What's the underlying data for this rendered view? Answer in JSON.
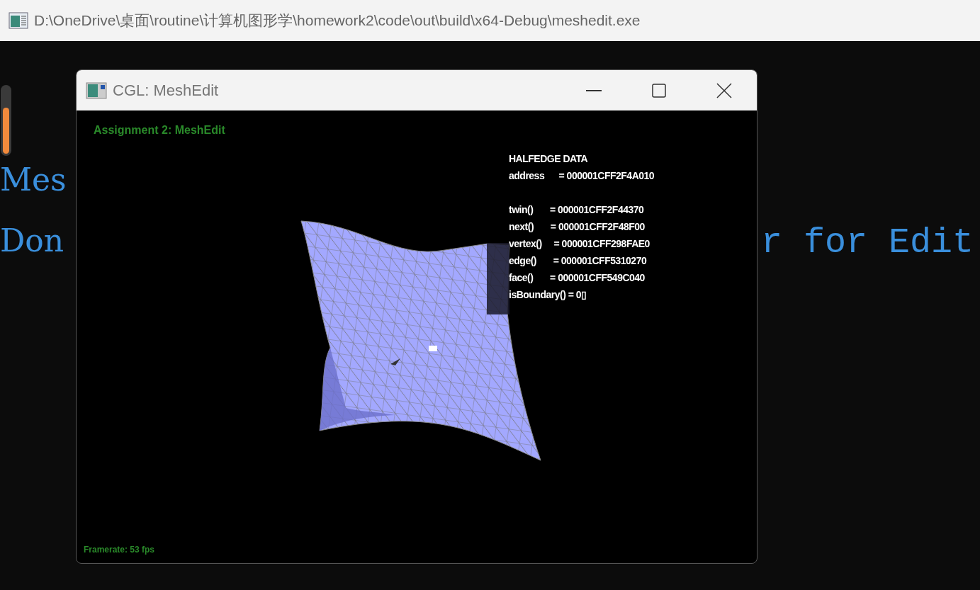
{
  "app_window": {
    "title": "D:\\OneDrive\\桌面\\routine\\计算机图形学\\homework2\\code\\out\\build\\x64-Debug\\meshedit.exe"
  },
  "console_text": {
    "line_1": "Mes",
    "line_2_left": "Don",
    "line_2_right": "r for Edit"
  },
  "viewer_window": {
    "title": "CGL: MeshEdit",
    "heading": "Assignment 2: MeshEdit",
    "halfedge_data": {
      "title": "HALFEDGE DATA",
      "address": "address      = 000001CFF2F4A010",
      "fields": [
        "twin()       = 000001CFF2F44370",
        "next()       = 000001CFF2F48F00",
        "vertex()     = 000001CFF298FAE0",
        "edge()       = 000001CFF5310270",
        "face()       = 000001CFF549C040",
        "isBoundary() = 0▯"
      ]
    },
    "framerate": "Framerate: 53 fps"
  }
}
